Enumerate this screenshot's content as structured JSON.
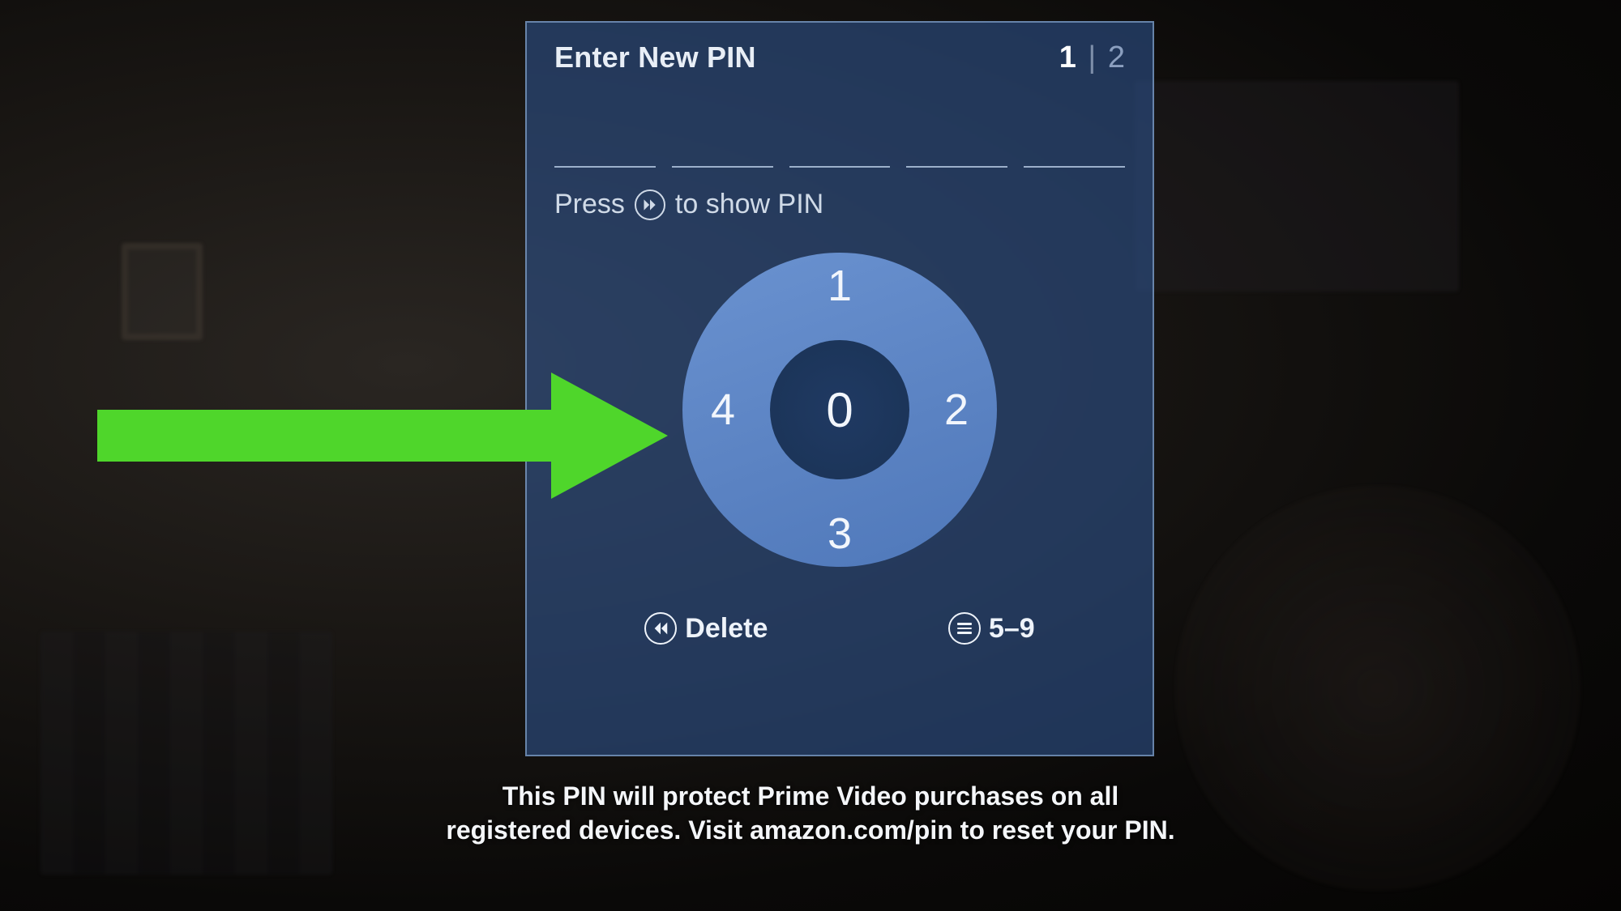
{
  "header": {
    "title": "Enter New PIN",
    "step_current": "1",
    "step_separator": "|",
    "step_total": "2"
  },
  "pin_slots_count": 5,
  "hint": {
    "prefix": "Press",
    "suffix": "to show PIN",
    "icon": "fast-forward-icon"
  },
  "dpad": {
    "up": "1",
    "right": "2",
    "down": "3",
    "left": "4",
    "center": "0"
  },
  "actions": {
    "delete": {
      "label": "Delete",
      "icon": "rewind-icon"
    },
    "alt_range": {
      "label": "5–9",
      "icon": "menu-icon"
    }
  },
  "footer": "This PIN will protect Prime Video purchases on all registered devices. Visit amazon.com/pin to reset your PIN.",
  "annotation": {
    "type": "arrow",
    "color": "#4fd62b",
    "direction": "right"
  },
  "colors": {
    "panel_bg": "rgba(46,84,144,0.58)",
    "ring": "#5e86c4",
    "accent_arrow": "#4fd62b"
  }
}
